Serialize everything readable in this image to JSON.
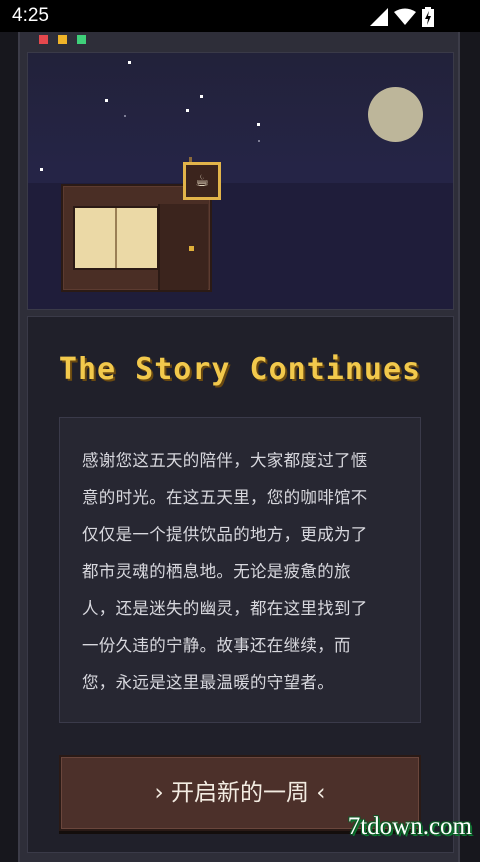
{
  "status_bar": {
    "time": "4:25",
    "icons": [
      "signal-icon",
      "wifi-icon",
      "battery-charging-icon"
    ]
  },
  "window_controls": {
    "colors": [
      "#e5484d",
      "#f0b429",
      "#3fd07a"
    ]
  },
  "scene": {
    "sign_glyph": "☕",
    "colors": {
      "sky": "#252446",
      "moon": "#bdb69a",
      "shop_wall": "#4a2e25",
      "window_light": "#ebd9a6",
      "sign_frame": "#e2b44a"
    }
  },
  "story": {
    "title": "The Story Continues",
    "lines": [
      "感谢您这五天的陪伴，大家都度过了惬",
      "意的时光。在这五天里，您的咖啡馆不",
      "仅仅是一个提供饮品的地方，更成为了",
      "都市灵魂的栖息地。无论是疲惫的旅",
      "人，还是迷失的幽灵，都在这里找到了",
      "一份久违的宁静。故事还在继续，而",
      "您，永远是这里最温暖的守望者。"
    ],
    "button_label": "› 开启新的一周 ‹"
  },
  "watermark": "7tdown.com",
  "accent_color": "#f2c94c"
}
